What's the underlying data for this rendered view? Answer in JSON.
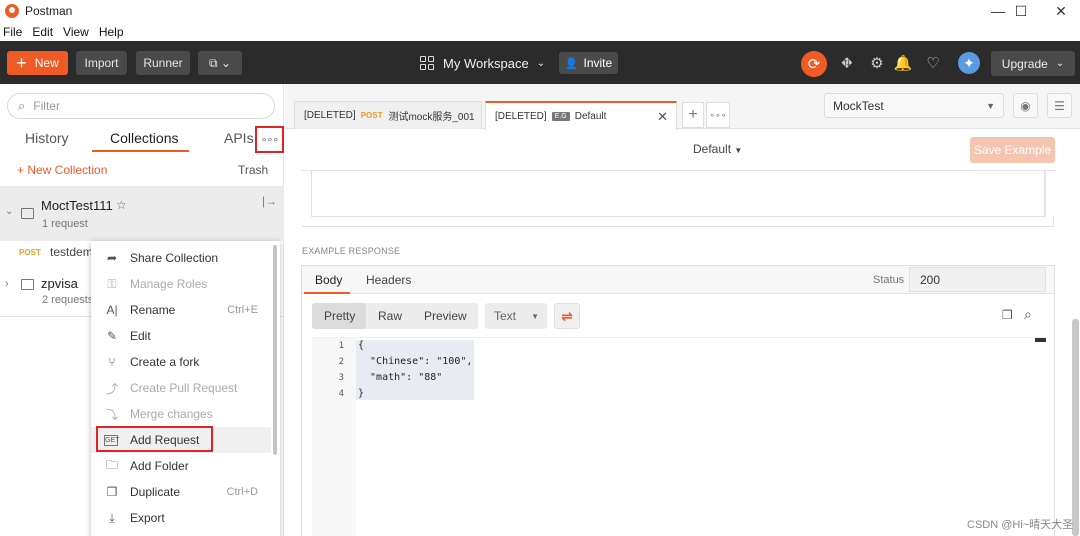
{
  "window": {
    "title": "Postman",
    "minimize": "—",
    "maximize": "☐",
    "close": "✕"
  },
  "menu": [
    "File",
    "Edit",
    "View",
    "Help"
  ],
  "toolbar": {
    "new_label": "New",
    "import_label": "Import",
    "runner_label": "Runner",
    "workspace_label": "My Workspace",
    "invite_label": "Invite",
    "upgrade_label": "Upgrade",
    "accent": "#ef5b25"
  },
  "sidebar": {
    "filter_placeholder": "Filter",
    "tabs": [
      "History",
      "Collections",
      "APIs"
    ],
    "active_tab": "Collections",
    "new_collection_label": "+ New Collection",
    "trash_label": "Trash",
    "collections": [
      {
        "name": "MoctTest111",
        "sub": "1 request"
      },
      {
        "name": "zpvisa",
        "sub": "2 requests"
      }
    ],
    "request": {
      "method": "POST",
      "name": "testdem"
    }
  },
  "context_menu": [
    {
      "label": "Share Collection",
      "shortcut": "",
      "icon": "share-icon",
      "disabled": false
    },
    {
      "label": "Manage Roles",
      "shortcut": "",
      "icon": "roles-icon",
      "disabled": true
    },
    {
      "label": "Rename",
      "shortcut": "Ctrl+E",
      "icon": "rename-icon",
      "disabled": false
    },
    {
      "label": "Edit",
      "shortcut": "",
      "icon": "pencil-icon",
      "disabled": false
    },
    {
      "label": "Create a fork",
      "shortcut": "",
      "icon": "fork-icon",
      "disabled": false
    },
    {
      "label": "Create Pull Request",
      "shortcut": "",
      "icon": "pull-request-icon",
      "disabled": true
    },
    {
      "label": "Merge changes",
      "shortcut": "",
      "icon": "merge-icon",
      "disabled": true
    },
    {
      "label": "Add Request",
      "shortcut": "",
      "icon": "get-request-icon",
      "disabled": false
    },
    {
      "label": "Add Folder",
      "shortcut": "",
      "icon": "folder-add-icon",
      "disabled": false
    },
    {
      "label": "Duplicate",
      "shortcut": "Ctrl+D",
      "icon": "duplicate-icon",
      "disabled": false
    },
    {
      "label": "Export",
      "shortcut": "",
      "icon": "export-icon",
      "disabled": false
    }
  ],
  "tabs": [
    {
      "prefix": "[DELETED]",
      "method": "POST",
      "name": "测试mock服务_001"
    },
    {
      "prefix": "[DELETED]",
      "method": "E.G",
      "name": "Default"
    }
  ],
  "environment": {
    "selected": "MockTest"
  },
  "example": {
    "name_dropdown": "Default",
    "save_label": "Save Example",
    "section_label": "EXAMPLE RESPONSE",
    "resp_tabs": [
      "Body",
      "Headers"
    ],
    "status_label": "Status",
    "status_value": "200",
    "formats": [
      "Pretty",
      "Raw",
      "Preview"
    ],
    "language": "Text"
  },
  "code_lines": [
    {
      "n": "1",
      "text": "{"
    },
    {
      "n": "2",
      "text": "  \"Chinese\": \"100\","
    },
    {
      "n": "3",
      "text": "  \"math\": \"88\""
    },
    {
      "n": "4",
      "text": "}"
    }
  ],
  "watermark": "CSDN @Hi~晴天大圣"
}
